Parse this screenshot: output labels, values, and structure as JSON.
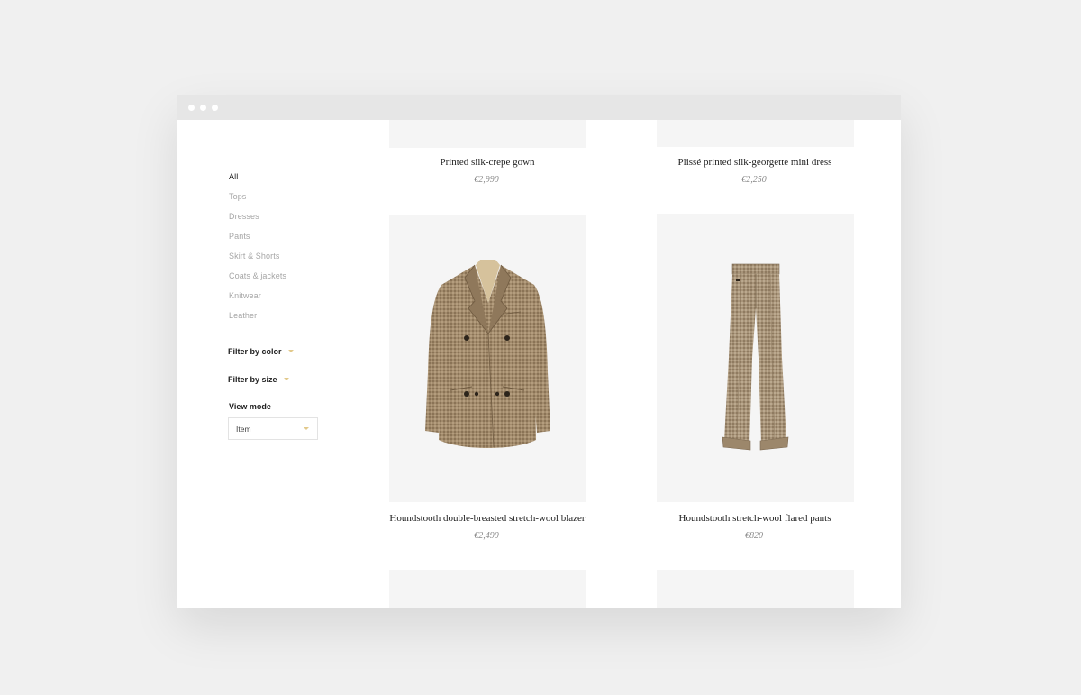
{
  "sidebar": {
    "categories": [
      "All",
      "Tops",
      "Dresses",
      "Pants",
      "Skirt & Shorts",
      "Coats & jackets",
      "Knitwear",
      "Leather"
    ],
    "filter_color": "Filter by color",
    "filter_size": "Filter by size",
    "view_mode_label": "View mode",
    "view_mode_value": "Item"
  },
  "products": [
    {
      "name": "Printed silk-crepe gown",
      "price": "€2,990",
      "image": "none"
    },
    {
      "name": "Plissé printed silk-georgette mini dress",
      "price": "€2,250",
      "image": "none"
    },
    {
      "name": "Houndstooth double-breasted stretch-wool blazer",
      "price": "€2,490",
      "image": "blazer"
    },
    {
      "name": "Houndstooth stretch-wool flared pants",
      "price": "€820",
      "image": "pants"
    }
  ],
  "colors": {
    "accent": "#e2c98b",
    "background": "#f0f0f0",
    "tile": "#f5f5f5",
    "fabric": "#9c8567"
  }
}
